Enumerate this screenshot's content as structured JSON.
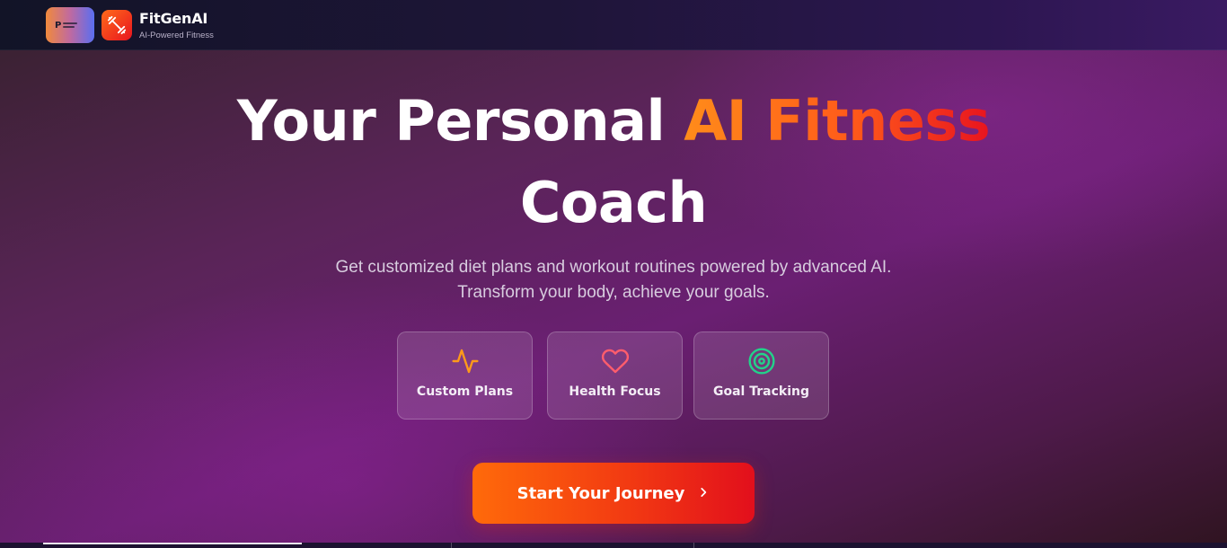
{
  "nav": {
    "partner_logo_text": "P",
    "brand_icon": "dumbbell-icon",
    "brand_name": "FitGenAI",
    "brand_tagline": "AI-Powered Fitness"
  },
  "hero": {
    "headline_part1": "Your Personal ",
    "headline_accent": "AI Fitness",
    "headline_part2": "Coach",
    "subtitle_line1": "Get customized diet plans and workout routines powered by advanced AI.",
    "subtitle_line2": "Transform your body, achieve your goals.",
    "features": [
      {
        "icon": "activity-pulse-icon",
        "label": "Custom Plans",
        "icon_color": "#ff9a1a"
      },
      {
        "icon": "heart-icon",
        "label": "Health Focus",
        "icon_color": "#ff5d6c"
      },
      {
        "icon": "target-icon",
        "label": "Goal Tracking",
        "icon_color": "#22d38a"
      }
    ],
    "cta_label": "Start Your Journey",
    "cta_icon": "chevron-right-icon"
  },
  "colors": {
    "accent_orange": "#ff8c1a",
    "accent_red": "#e8141f",
    "hero_purple": "#6a1f72",
    "nav_dark": "#121427"
  }
}
